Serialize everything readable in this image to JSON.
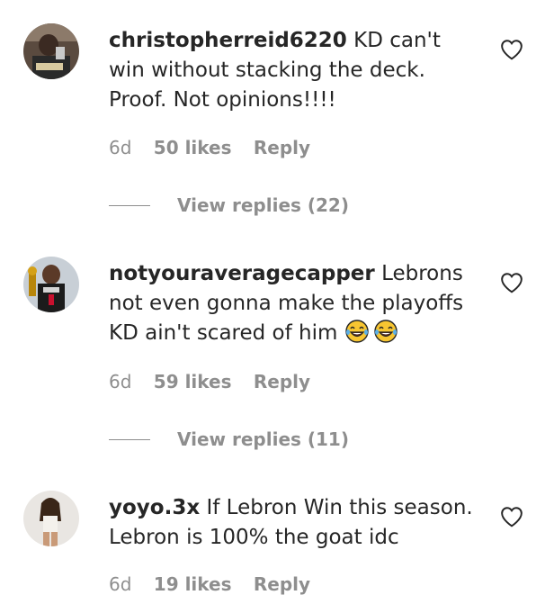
{
  "comments": [
    {
      "username": "christopherreid6220",
      "text": "KD can't win without stacking the deck. Proof. Not opinions!!!!",
      "time": "6d",
      "likes": "50 likes",
      "reply_label": "Reply",
      "view_replies": "View replies (22)",
      "avatar_icon": "user-photo"
    },
    {
      "username": "notyouraveragecapper",
      "text": "Lebrons not even gonna make the playoffs KD ain't scared of him",
      "time": "6d",
      "likes": "59 likes",
      "reply_label": "Reply",
      "view_replies": "View replies (11)",
      "avatar_icon": "basketball-player-photo",
      "emojis": [
        "laughing-tears-emoji",
        "laughing-tears-emoji"
      ]
    },
    {
      "username": "yoyo.3x",
      "text": "If Lebron Win this season. Lebron is 100% the goat idc",
      "time": "6d",
      "likes": "19 likes",
      "reply_label": "Reply",
      "avatar_icon": "user-photo"
    }
  ],
  "colors": {
    "text": "#262626",
    "secondary": "#8e8e8e",
    "background": "#ffffff"
  },
  "icons": {
    "like": "heart-outline-icon"
  }
}
